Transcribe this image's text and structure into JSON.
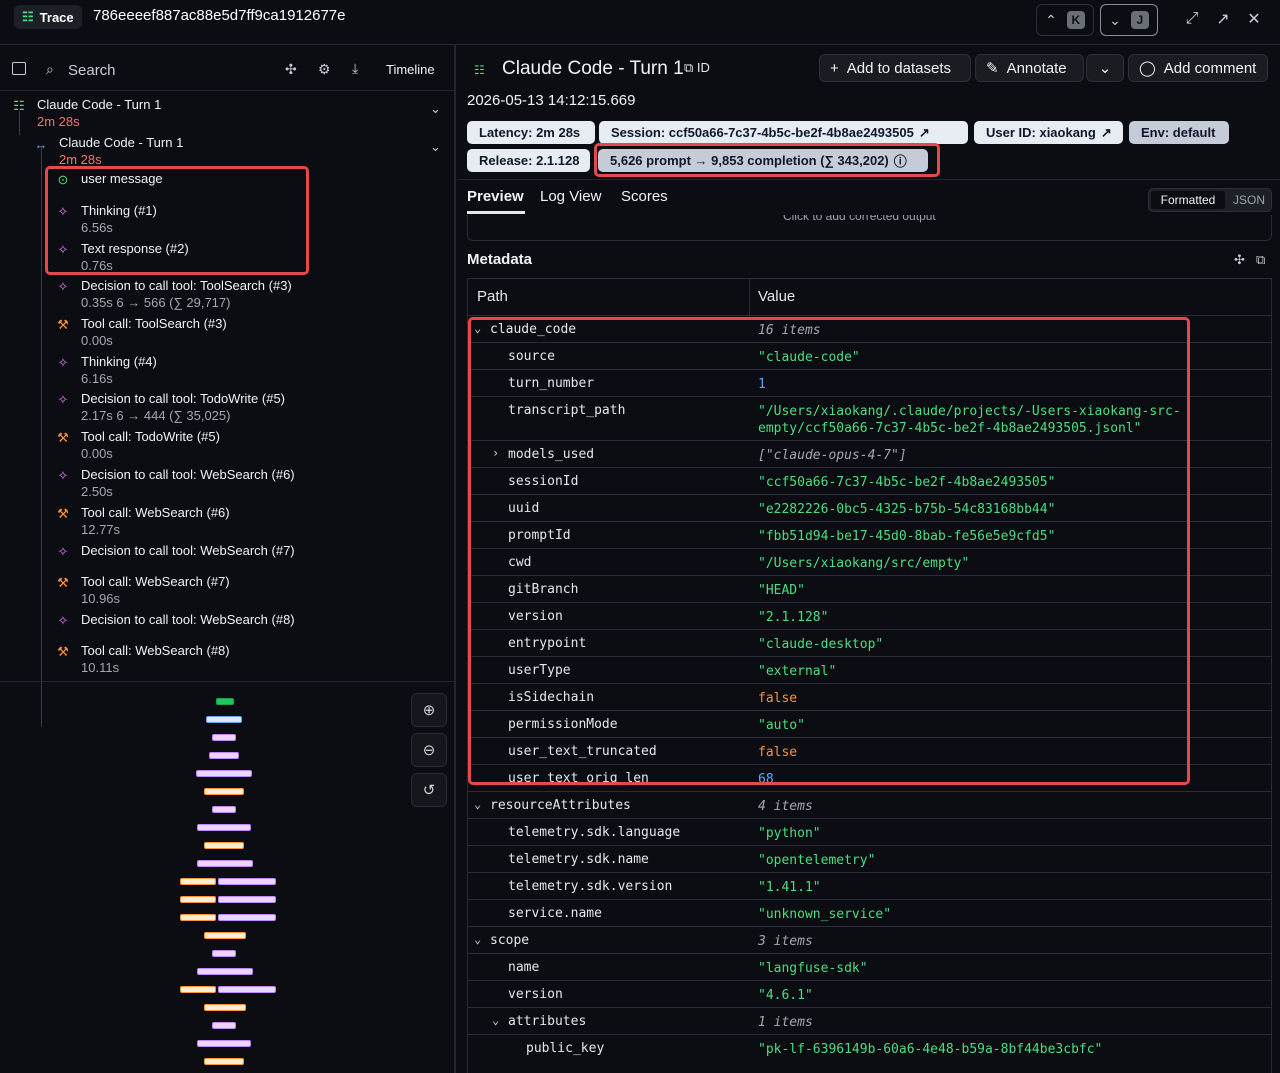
{
  "header": {
    "trace_label": "Trace",
    "trace_id": "786eeeef887ac88e5d7ff9ca1912677e",
    "prev_key": "K",
    "next_key": "J"
  },
  "left_panel": {
    "search_placeholder": "Search",
    "timeline_label": "Timeline",
    "tree": [
      {
        "label": "Claude Code - Turn 1",
        "sub": "2m 28s",
        "icon": "list-tree-icon"
      },
      {
        "label": "Claude Code - Turn 1",
        "sub": "2m 28s",
        "icon": "arrows-icon"
      },
      {
        "label": "user message",
        "sub": "",
        "icon": "circle-check-icon"
      },
      {
        "label": "Thinking (#1)",
        "sub": "6.56s",
        "icon": "generation-icon"
      },
      {
        "label": "Text response (#2)",
        "sub": "0.76s",
        "icon": "generation-icon"
      },
      {
        "label": "Decision to call tool: ToolSearch (#3)",
        "sub": "0.35s   6 → 566 (∑ 29,717)",
        "icon": "generation-icon"
      },
      {
        "label": "Tool call: ToolSearch (#3)",
        "sub": "0.00s",
        "icon": "wrench-icon"
      },
      {
        "label": "Thinking (#4)",
        "sub": "6.16s",
        "icon": "generation-icon"
      },
      {
        "label": "Decision to call tool: TodoWrite (#5)",
        "sub": "2.17s   6 → 444 (∑ 35,025)",
        "icon": "generation-icon"
      },
      {
        "label": "Tool call: TodoWrite (#5)",
        "sub": "0.00s",
        "icon": "wrench-icon"
      },
      {
        "label": "Decision to call tool: WebSearch (#6)",
        "sub": "2.50s",
        "icon": "generation-icon"
      },
      {
        "label": "Tool call: WebSearch (#6)",
        "sub": "12.77s",
        "icon": "wrench-icon"
      },
      {
        "label": "Decision to call tool: WebSearch (#7)",
        "sub": "",
        "icon": "generation-icon"
      },
      {
        "label": "Tool call: WebSearch (#7)",
        "sub": "10.96s",
        "icon": "wrench-icon"
      },
      {
        "label": "Decision to call tool: WebSearch (#8)",
        "sub": "",
        "icon": "generation-icon"
      },
      {
        "label": "Tool call: WebSearch (#8)",
        "sub": "10.11s",
        "icon": "wrench-icon"
      }
    ]
  },
  "detail": {
    "title": "Claude Code - Turn 1",
    "id_label": "ID",
    "add_datasets": "Add to datasets",
    "annotate": "Annotate",
    "add_comment": "Add comment",
    "timestamp": "2026-05-13 14:12:15.669",
    "latency": "Latency: 2m 28s",
    "session": "Session: ccf50a66-7c37-4b5c-be2f-4b8ae2493505",
    "user_id": "User ID: xiaokang",
    "env": "Env: default",
    "release": "Release: 2.1.128",
    "tokens": "5,626 prompt → 9,853 completion (∑ 343,202)",
    "tabs": [
      "Preview",
      "Log View",
      "Scores"
    ],
    "view_formatted": "Formatted",
    "view_json": "JSON",
    "cut_text": "Click to add corrected output",
    "metadata_title": "Metadata",
    "col_path": "Path",
    "col_value": "Value"
  },
  "metadata_rows": [
    {
      "path": "claude_code",
      "value": "16 items",
      "kind": "meta",
      "depth": 0,
      "toggle": "open"
    },
    {
      "path": "source",
      "value": "\"claude-code\"",
      "kind": "str",
      "depth": 1
    },
    {
      "path": "turn_number",
      "value": "1",
      "kind": "num",
      "depth": 1
    },
    {
      "path": "transcript_path",
      "value": "\"/Users/xiaokang/.claude/projects/-Users-xiaokang-src-\nempty/ccf50a66-7c37-4b5c-be2f-4b8ae2493505.jsonl\"",
      "kind": "str",
      "depth": 1
    },
    {
      "path": "models_used",
      "value": "[\"claude-opus-4-7\"]",
      "kind": "meta",
      "depth": 1,
      "toggle": "closed"
    },
    {
      "path": "sessionId",
      "value": "\"ccf50a66-7c37-4b5c-be2f-4b8ae2493505\"",
      "kind": "str",
      "depth": 1
    },
    {
      "path": "uuid",
      "value": "\"e2282226-0bc5-4325-b75b-54c83168bb44\"",
      "kind": "str",
      "depth": 1
    },
    {
      "path": "promptId",
      "value": "\"fbb51d94-be17-45d0-8bab-fe56e5e9cfd5\"",
      "kind": "str",
      "depth": 1
    },
    {
      "path": "cwd",
      "value": "\"/Users/xiaokang/src/empty\"",
      "kind": "str",
      "depth": 1
    },
    {
      "path": "gitBranch",
      "value": "\"HEAD\"",
      "kind": "str",
      "depth": 1
    },
    {
      "path": "version",
      "value": "\"2.1.128\"",
      "kind": "str",
      "depth": 1
    },
    {
      "path": "entrypoint",
      "value": "\"claude-desktop\"",
      "kind": "str",
      "depth": 1
    },
    {
      "path": "userType",
      "value": "\"external\"",
      "kind": "str",
      "depth": 1
    },
    {
      "path": "isSidechain",
      "value": "false",
      "kind": "bool",
      "depth": 1
    },
    {
      "path": "permissionMode",
      "value": "\"auto\"",
      "kind": "str",
      "depth": 1
    },
    {
      "path": "user_text_truncated",
      "value": "false",
      "kind": "bool",
      "depth": 1
    },
    {
      "path": "user_text_orig_len",
      "value": "68",
      "kind": "num",
      "depth": 1
    },
    {
      "path": "resourceAttributes",
      "value": "4 items",
      "kind": "meta",
      "depth": 0,
      "toggle": "open"
    },
    {
      "path": "telemetry.sdk.language",
      "value": "\"python\"",
      "kind": "str",
      "depth": 1
    },
    {
      "path": "telemetry.sdk.name",
      "value": "\"opentelemetry\"",
      "kind": "str",
      "depth": 1
    },
    {
      "path": "telemetry.sdk.version",
      "value": "\"1.41.1\"",
      "kind": "str",
      "depth": 1
    },
    {
      "path": "service.name",
      "value": "\"unknown_service\"",
      "kind": "str",
      "depth": 1
    },
    {
      "path": "scope",
      "value": "3 items",
      "kind": "meta",
      "depth": 0,
      "toggle": "open"
    },
    {
      "path": "name",
      "value": "\"langfuse-sdk\"",
      "kind": "str",
      "depth": 1
    },
    {
      "path": "version",
      "value": "\"4.6.1\"",
      "kind": "str",
      "depth": 1
    },
    {
      "path": "attributes",
      "value": "1 items",
      "kind": "meta",
      "depth": 1,
      "toggle": "open"
    },
    {
      "path": "public_key",
      "value": "\"pk-lf-6396149b-60a6-4e48-b59a-8bf44be3cbfc\"",
      "kind": "str",
      "depth": 2
    }
  ]
}
